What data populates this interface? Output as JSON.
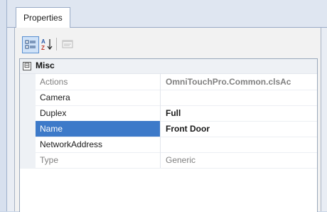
{
  "tabs": [
    {
      "label": "Properties",
      "active": true
    }
  ],
  "toolbar": {
    "categorized": {
      "icon": "categorized-icon",
      "pressed": true
    },
    "alphabetical": {
      "icon": "sort-alphabetical-icon"
    },
    "property_pages": {
      "icon": "property-pages-icon",
      "enabled": false
    }
  },
  "category": {
    "expander": "⊟",
    "label": "Misc",
    "expanded": true
  },
  "rows": [
    {
      "name": "Actions",
      "value": "OmniTouchPro.Common.clsAc",
      "readonly": true,
      "bold_value": true
    },
    {
      "name": "Camera",
      "value": "",
      "readonly": false
    },
    {
      "name": "Duplex",
      "value": "Full",
      "readonly": false,
      "bold_value": true
    },
    {
      "name": "Name",
      "value": "Front Door",
      "readonly": false,
      "bold_value": true,
      "selected": true
    },
    {
      "name": "NetworkAddress",
      "value": "",
      "readonly": false
    },
    {
      "name": "Type",
      "value": "Generic",
      "readonly": true
    }
  ],
  "colors": {
    "selection": "#3d7ac9",
    "grid_background": "#ffffff",
    "readonly_text": "#808080"
  }
}
